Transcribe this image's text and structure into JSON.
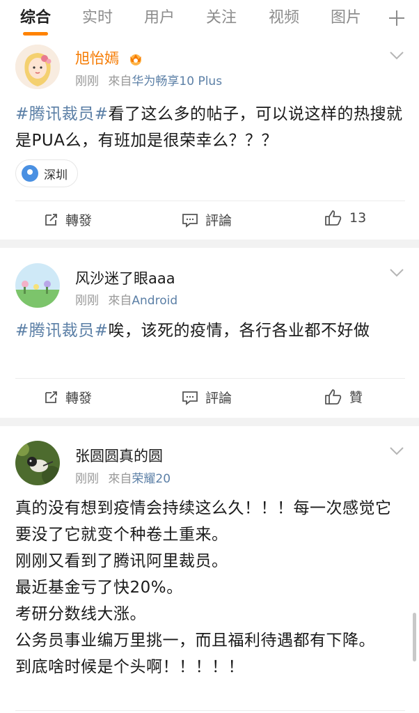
{
  "tabs": [
    {
      "label": "综合",
      "active": true
    },
    {
      "label": "实时",
      "active": false
    },
    {
      "label": "用户",
      "active": false
    },
    {
      "label": "关注",
      "active": false
    },
    {
      "label": "视频",
      "active": false
    },
    {
      "label": "图片",
      "active": false
    }
  ],
  "colors": {
    "accent": "#ff8200",
    "link": "#5b7fa6",
    "vip_name": "#f57a00"
  },
  "posts": [
    {
      "username": "旭怡嫣",
      "time": "刚刚",
      "from_prefix": "來自",
      "device": "华为畅享10 Plus",
      "topic": "#腾讯裁员#",
      "text": "看了这么多的帖子，可以说这样的热搜就是PUA么，有班加是很荣幸么？？？",
      "location": "深圳",
      "actions": {
        "repost": "轉發",
        "comment": "評論",
        "like": "13"
      }
    },
    {
      "username": "风沙迷了眼aaa",
      "time": "刚刚",
      "from_prefix": "來自",
      "device": "Android",
      "topic": "#腾讯裁员#",
      "text": "唉，该死的疫情，各行各业都不好做",
      "actions": {
        "repost": "轉發",
        "comment": "評論",
        "like": "贊"
      }
    },
    {
      "username": "张圆圆真的圆",
      "time": "刚刚",
      "from_prefix": "來自",
      "device": "荣耀20",
      "lines": [
        "真的没有想到疫情会持续这么久！！！每一次感觉它要没了它就变个种卷土重来。",
        "刚刚又看到了腾讯阿里裁员。",
        "最近基金亏了快20%。",
        "考研分数线大涨。",
        "公务员事业编万里挑一，而且福利待遇都有下降。",
        "到底啥时候是个头啊！！！！！"
      ]
    }
  ]
}
